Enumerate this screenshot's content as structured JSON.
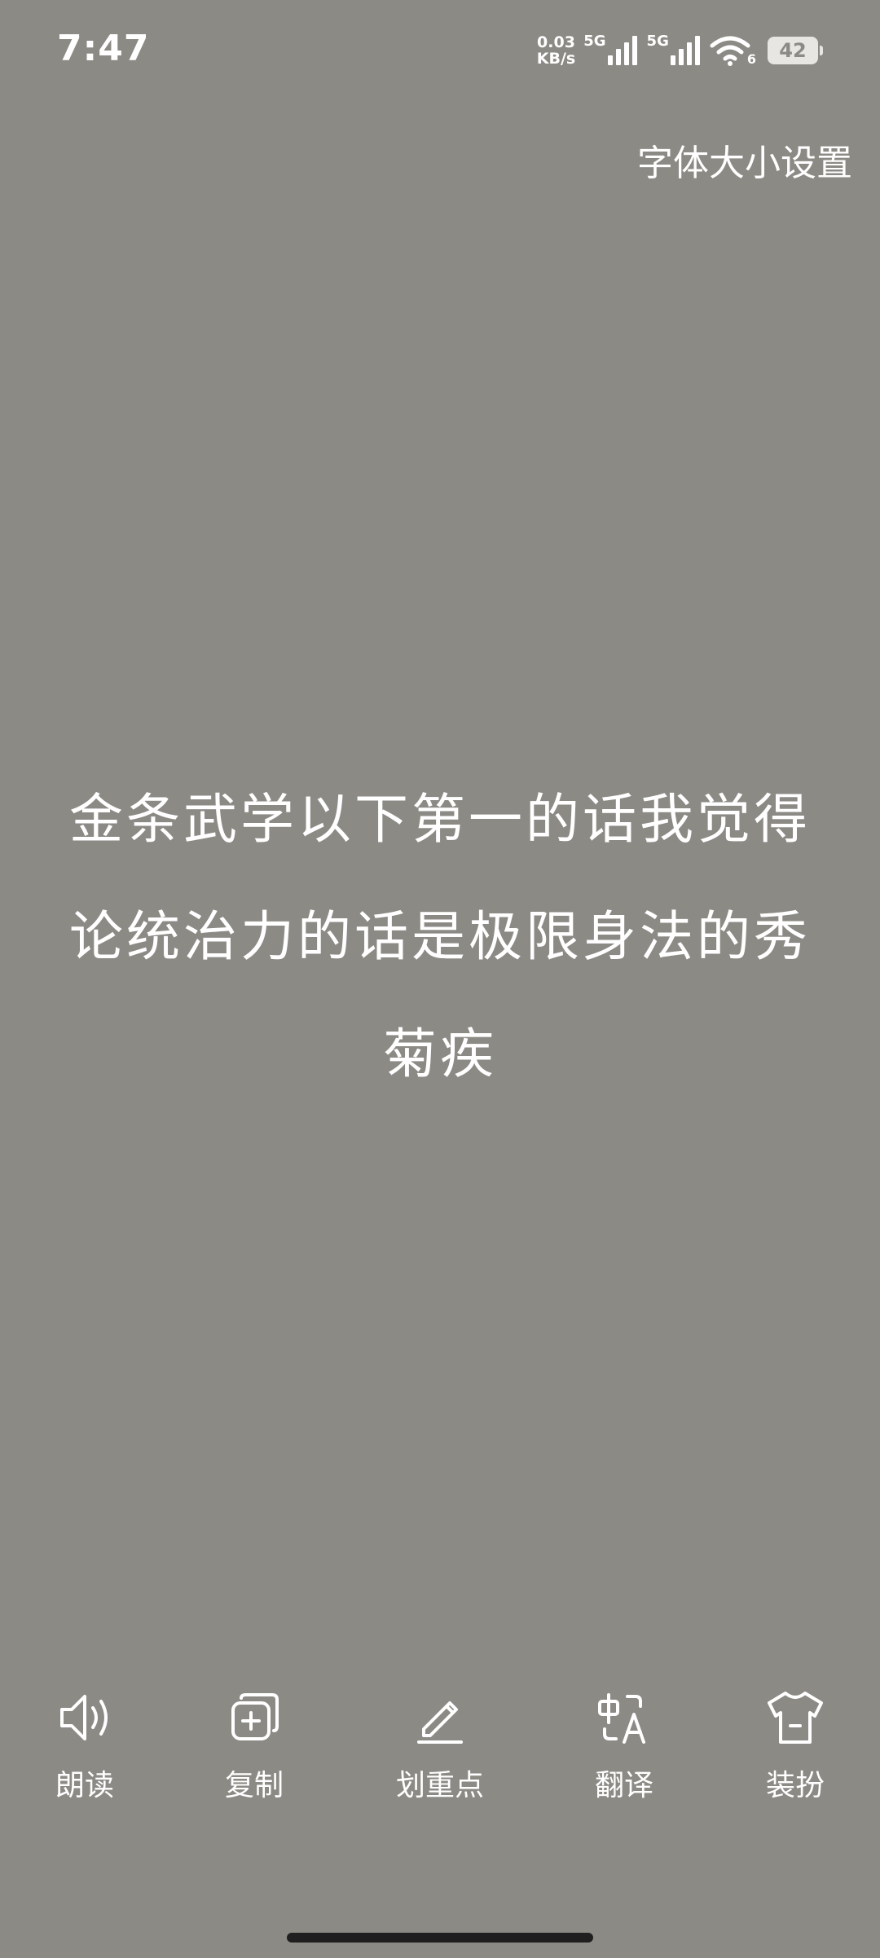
{
  "status_bar": {
    "time": "7:47",
    "net_speed_value": "0.03",
    "net_speed_unit": "KB/s",
    "sim1_label": "5G",
    "sim2_label": "5G",
    "wifi_label": "6",
    "battery_level": "42"
  },
  "header": {
    "font_size_setting_label": "字体大小设置"
  },
  "content": {
    "text": "金条武学以下第一的话我觉得论统治力的话是极限身法的秀菊疾"
  },
  "toolbar": {
    "items": [
      {
        "label": "朗读",
        "icon": "speaker-icon"
      },
      {
        "label": "复制",
        "icon": "copy-icon"
      },
      {
        "label": "划重点",
        "icon": "pencil-icon"
      },
      {
        "label": "翻译",
        "icon": "translate-icon"
      },
      {
        "label": "装扮",
        "icon": "tshirt-icon"
      }
    ]
  },
  "colors": {
    "background": "#8c8a85",
    "text": "#ffffff"
  }
}
